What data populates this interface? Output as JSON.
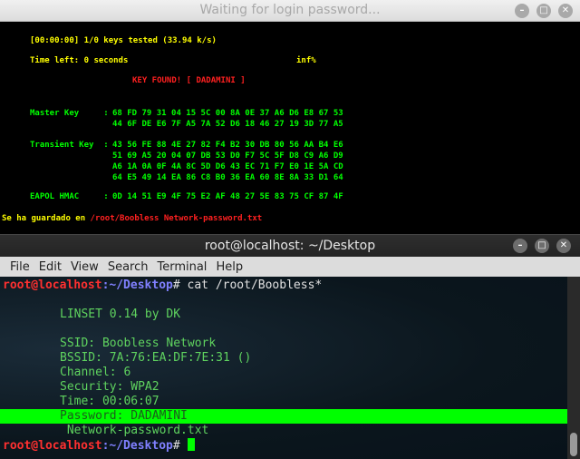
{
  "aircrack_window": {
    "title": "Waiting for login password...",
    "keys_tested": "[00:00:00] 1/0 keys tested (33.94 k/s)",
    "time_left": "Time left: 0 seconds",
    "percent": "inf%",
    "key_found": "KEY FOUND! [ DADAMINI ]",
    "master_key_label": "Master Key     :",
    "master_key": [
      "68 FD 79 31 04 15 5C 00 8A 0E 37 A6 D6 E8 67 53",
      "44 6F DE E6 7F A5 7A 52 D6 18 46 27 19 3D 77 A5"
    ],
    "transient_key_label": "Transient Key  :",
    "transient_key": [
      "43 56 FE 88 4E 27 82 F4 B2 30 DB 80 56 AA B4 E6",
      "51 69 A5 20 04 07 DB 53 D0 F7 5C 5F D8 C9 A6 D9",
      "A6 1A 0A 0F 4A 8C 5D D6 43 EC 71 F7 E0 1E 5A CD",
      "64 E5 49 14 EA 86 C8 B0 36 EA 60 8E 8A 33 D1 64"
    ],
    "eapol_label": "EAPOL HMAC     :",
    "eapol_hmac": "0D 14 51 E9 4F 75 E2 AF 48 27 5E 83 75 CF 87 4F",
    "saved_prefix": "Se ha guardado en ",
    "saved_path": "/root/Boobless Network-password.txt"
  },
  "terminal_window": {
    "title": "root@localhost: ~/Desktop",
    "menu": [
      "File",
      "Edit",
      "View",
      "Search",
      "Terminal",
      "Help"
    ],
    "prompt_user": "root@localhost",
    "prompt_path": ":~/Desktop",
    "prompt_symbol": "#",
    "command": " cat /root/Boobless*",
    "lines": {
      "linset": "LINSET 0.14 by DK",
      "ssid": "SSID: Boobless Network",
      "bssid": "BSSID: 7A:76:EA:DF:7E:31 ()",
      "channel": "Channel: 6",
      "security": "Security: WPA2",
      "time": "Time: 00:06:07",
      "password": "Password: DADAMINI",
      "file": " Network-password.txt"
    }
  },
  "colors": {
    "console_yellow": "#ffff00",
    "console_red": "#ff2020",
    "console_green": "#00ff00",
    "prompt_red": "#ff3030",
    "prompt_blue": "#8080ff"
  }
}
